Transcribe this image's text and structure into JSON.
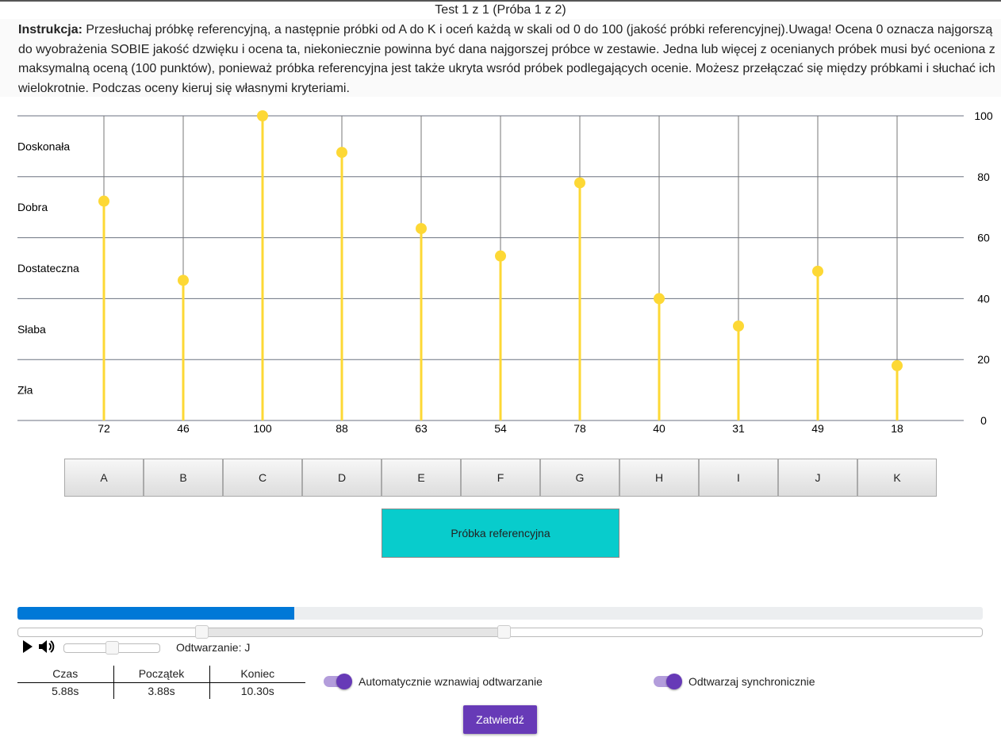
{
  "title": "Test 1 z 1 (Próba 1 z 2)",
  "instruction": {
    "label": "Instrukcja:",
    "text": " Przesłuchaj próbkę referencyjną, a następnie próbki od A do K i oceń każdą w skali od 0 do 100 (jakość próbki referencyjnej).Uwaga! Ocena 0 oznacza najgorszą do wyobrażenia SOBIE jakość dzwięku i ocena ta, niekoniecznie powinna być dana najgorszej próbce w zestawie. Jedna lub więcej z ocenianych próbek musi być oceniona z maksymalną oceną (100 punktów), ponieważ próbka referencyjna jest także ukryta wsród próbek podlegających ocenie. Możesz przełączać się między próbkami i słuchać ich wielokrotnie. Podczas oceny kieruj się własnymi kryteriami."
  },
  "chart_data": {
    "type": "scatter",
    "categories": [
      "A",
      "B",
      "C",
      "D",
      "E",
      "F",
      "G",
      "H",
      "I",
      "J",
      "K"
    ],
    "values": [
      72,
      46,
      100,
      88,
      63,
      54,
      78,
      40,
      31,
      49,
      18
    ],
    "ylim": [
      0,
      100
    ],
    "yticks": [
      0,
      20,
      40,
      60,
      80,
      100
    ],
    "bands": [
      "Doskonała",
      "Dobra",
      "Dostateczna",
      "Słaba",
      "Zła"
    ],
    "color": "#fdd835"
  },
  "samples": [
    "A",
    "B",
    "C",
    "D",
    "E",
    "F",
    "G",
    "H",
    "I",
    "J",
    "K"
  ],
  "reference_label": "Próbka referencyjna",
  "player": {
    "progress_percent": 28.7,
    "loop_start_percent": 19,
    "loop_end_percent": 50.4,
    "volume_percent": 50,
    "playing_label": "Odtwarzanie: J"
  },
  "times": {
    "headers": [
      "Czas",
      "Początek",
      "Koniec"
    ],
    "values": [
      "5.88s",
      "3.88s",
      "10.30s"
    ]
  },
  "toggles": [
    {
      "label": "Automatycznie wznawiaj odtwarzanie",
      "on": true
    },
    {
      "label": "Odtwarzaj synchronicznie",
      "on": true
    }
  ],
  "submit_label": "Zatwierdź",
  "colors": {
    "accent": "#673ab7",
    "reference": "#08cccc",
    "progress": "#0078d7"
  }
}
